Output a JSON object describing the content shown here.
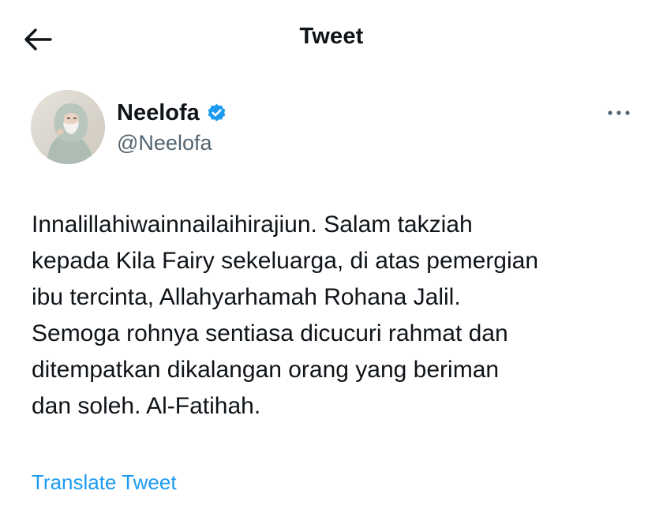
{
  "header": {
    "title": "Tweet",
    "back_icon": "arrow-left-icon"
  },
  "tweet": {
    "author_name": "Neelofa",
    "author_handle": "@Neelofa",
    "verified_icon": "verified-badge-icon",
    "more_icon": "more-horizontal-icon",
    "text": "Innalillahiwainnailaihirajiun. Salam takziah\nkepada Kila Fairy sekeluarga, di atas pemergian\nibu tercinta, Allahyarhamah Rohana Jalil.\nSemoga rohnya sentiasa dicucuri rahmat dan\nditempatkan dikalangan orang yang beriman\ndan soleh. Al-Fatihah.",
    "translate_label": "Translate Tweet"
  },
  "colors": {
    "text_primary": "#0f1419",
    "text_secondary": "#536471",
    "link": "#1d9bf0",
    "verified": "#1d9bf0"
  }
}
